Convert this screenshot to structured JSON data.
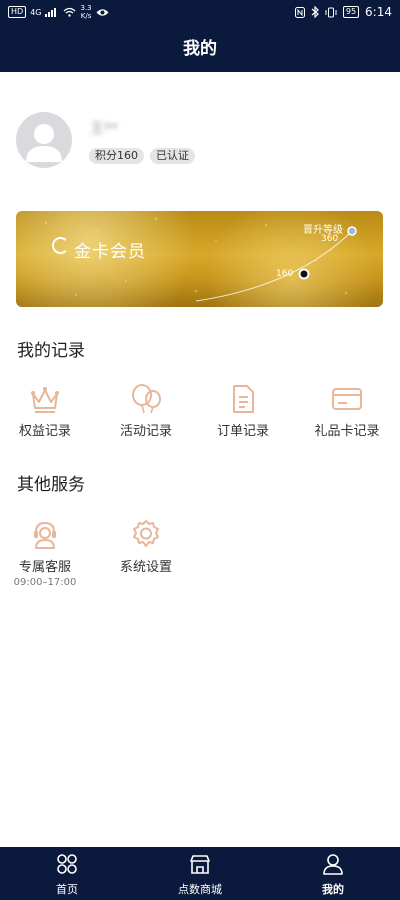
{
  "status_bar": {
    "network_chip": "HD",
    "signal": "4G",
    "speed_value": "3.3",
    "speed_unit": "K/s",
    "battery": "95",
    "time": "6:14"
  },
  "header": {
    "title": "我的"
  },
  "profile": {
    "name": "王**",
    "points_tag": "积分160",
    "verified_tag": "已认证"
  },
  "member_card": {
    "title": "金卡会员",
    "upgrade_label": "晋升等级",
    "upgrade_points": "360",
    "current_points": "160",
    "progress_fraction": 0.44
  },
  "records": {
    "title": "我的记录",
    "items": [
      {
        "label": "权益记录",
        "icon": "crown-icon"
      },
      {
        "label": "活动记录",
        "icon": "balloons-icon"
      },
      {
        "label": "订单记录",
        "icon": "document-icon"
      },
      {
        "label": "礼品卡记录",
        "icon": "card-icon"
      }
    ]
  },
  "services": {
    "title": "其他服务",
    "items": [
      {
        "label": "专属客服",
        "sub": "09:00–17:00",
        "icon": "headset-icon"
      },
      {
        "label": "系统设置",
        "icon": "gear-icon"
      }
    ]
  },
  "tab_bar": {
    "items": [
      {
        "label": "首页",
        "icon": "home-grid-icon"
      },
      {
        "label": "点数商城",
        "icon": "store-icon"
      },
      {
        "label": "我的",
        "icon": "user-icon",
        "active": true
      }
    ]
  },
  "colors": {
    "nav_bg": "#0b1a3c",
    "icon_accent": "#e8b69a",
    "gold": "#d7a92a"
  }
}
